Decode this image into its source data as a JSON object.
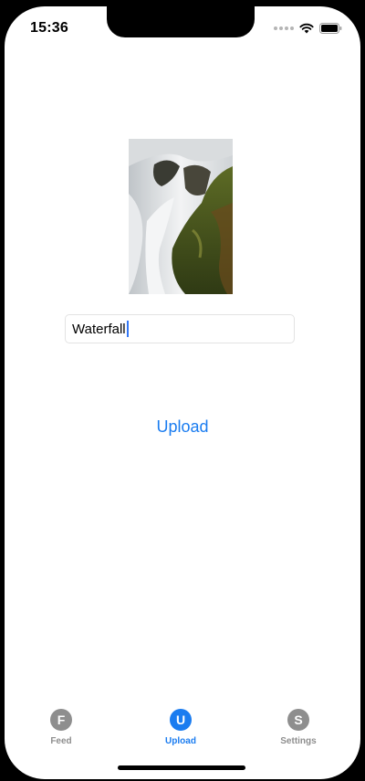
{
  "status_bar": {
    "time": "15:36",
    "icons": [
      "signal-dots-icon",
      "wifi-icon",
      "battery-icon"
    ]
  },
  "photo": {
    "subject": "waterfall-photo",
    "colors": {
      "water": "#e6e8ea",
      "moss": "#4b5a1e",
      "rock": "#2b2e22"
    }
  },
  "form": {
    "title_value": "Waterfall"
  },
  "actions": {
    "upload_label": "Upload"
  },
  "tabbar": {
    "active_color": "#1a7cf0",
    "inactive_color": "#8e8e8e",
    "tabs": [
      {
        "letter": "F",
        "label": "Feed",
        "active": false
      },
      {
        "letter": "U",
        "label": "Upload",
        "active": true
      },
      {
        "letter": "S",
        "label": "Settings",
        "active": false
      }
    ]
  }
}
